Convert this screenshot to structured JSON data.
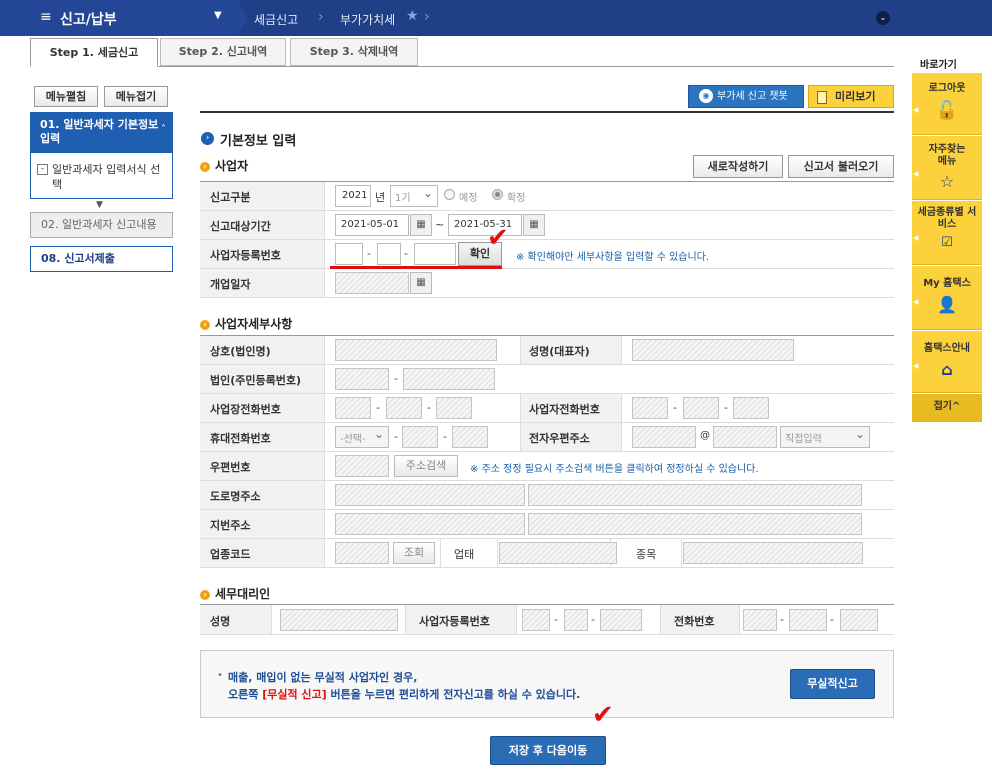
{
  "topbar": {
    "menu": "신고/납부",
    "crumb1": "세금신고",
    "crumb2": "부가가치세"
  },
  "tabs": [
    {
      "label": "Step 1. 세금신고"
    },
    {
      "label": "Step 2. 신고내역"
    },
    {
      "label": "Step 3. 삭제내역"
    }
  ],
  "sidebar": {
    "expand": "메뉴펼침",
    "collapse": "메뉴접기",
    "item1": "01. 일반과세자 기본정보 입력",
    "item1_sub": "일반과세자 입력서식 선택",
    "item2": "02. 일반과세자 신고내용",
    "item3": "08. 신고서제출"
  },
  "toolbar": {
    "chatbot": "부가세 신고 챗봇",
    "preview": "미리보기"
  },
  "basic": {
    "heading": "기본정보 입력",
    "section": "사업자",
    "new_btn": "새로작성하기",
    "load_btn": "신고서 불러오기",
    "type_label": "신고구분",
    "year": "2021",
    "year_unit": "년",
    "period": "1기",
    "opt_pre": "예정",
    "opt_conf": "확정",
    "term_label": "신고대상기간",
    "date_from": "2021-05-01",
    "tilde": "~",
    "date_to": "2021-05-31",
    "bizno_label": "사업자등록번호",
    "confirm_btn": "확인",
    "bizno_note": "※ 확인해야만 세부사항을 입력할 수 있습니다.",
    "open_label": "개업일자"
  },
  "detail": {
    "section": "사업자세부사항",
    "name_label": "상호(법인명)",
    "rep_label": "성명(대표자)",
    "corp_label": "법인(주민등록번호)",
    "tel_label": "사업장전화번호",
    "biztel_label": "사업자전화번호",
    "mobile_label": "휴대전화번호",
    "mobile_select": "-선택-",
    "email_label": "전자우편주소",
    "at": "@",
    "email_select": "직접입력",
    "zip_label": "우편번호",
    "zip_btn": "주소검색",
    "zip_note": "※ 주소 정정 필요시 주소검색 버튼을 클릭하여 정정하실 수 있습니다.",
    "road_label": "도로명주소",
    "jibun_label": "지번주소",
    "code_label": "업종코드",
    "code_btn": "조회",
    "type_label": "업태",
    "item_label": "종목"
  },
  "agent": {
    "section": "세무대리인",
    "name_label": "성명",
    "bizno_label": "사업자등록번호",
    "tel_label": "전화번호"
  },
  "notice": {
    "line1": "매출, 매입이 없는 무실적 사업자인 경우,",
    "line2a": "오른쪽",
    "line2b": "[무실적 신고]",
    "line2c": "버튼을 누르면 편리하게 전자신고를 하실 수 있습니다.",
    "btn": "무실적신고"
  },
  "save_btn": "저장 후 다음이동",
  "quick": {
    "title": "바로가기",
    "logout": "로그아웃",
    "faq": "자주찾는 메뉴",
    "taxsvc": "세금종류별 서비스",
    "my": "My 홈택스",
    "guide": "홈택스안내",
    "fold": "접기^"
  },
  "colors": {
    "nav": "#1f3f87",
    "accent_yellow": "#fbd23b",
    "blue_btn": "#2b6cb6",
    "red_mark": "#e01010"
  }
}
